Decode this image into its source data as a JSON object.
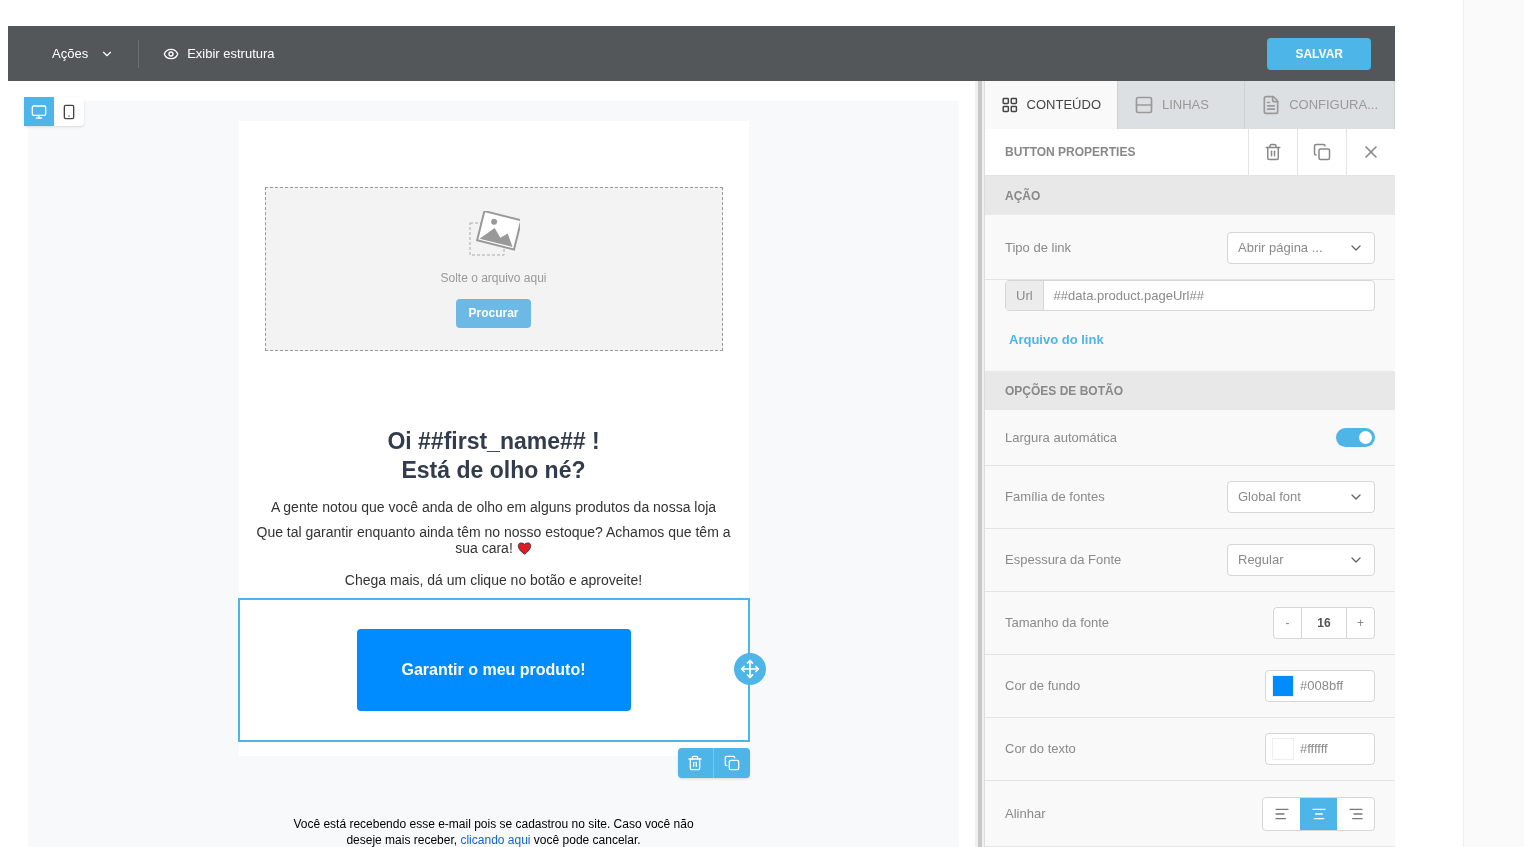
{
  "toolbar": {
    "actions_menu": "Ações",
    "structure_toggle": "Exibir estrutura",
    "save_button": "SALVAR"
  },
  "device_toggle": [
    {
      "kind": "desktop",
      "selected": true
    },
    {
      "kind": "mobile",
      "selected": false
    }
  ],
  "email": {
    "dropzone": {
      "text": "Solte o arquivo aqui",
      "button": "Procurar"
    },
    "heading": [
      "Oi ##first_name## !",
      "Está de olho né?"
    ],
    "paragraphs": [
      "A gente notou que você anda de olho em alguns produtos da nossa loja",
      "Que tal garantir enquanto ainda têm no nosso estoque? Achamos que têm a sua cara!",
      "Chega mais, dá um clique no botão e aproveite!"
    ],
    "cta_button": "Garantir o meu produto!",
    "footer": {
      "before": "Você está recebendo esse e-mail pois se cadastrou no site. Caso você não deseje mais receber,",
      "link": "clicando aqui",
      "after": "você pode cancelar."
    }
  },
  "panel": {
    "tabs": [
      {
        "label": "CONTEÚDO",
        "kind": "grid",
        "selected": true
      },
      {
        "label": "LINHAS",
        "kind": "rows",
        "selected": false
      },
      {
        "label": "CONFIGURA...",
        "kind": "doc",
        "selected": false
      }
    ],
    "title": "BUTTON PROPERTIES",
    "sections": [
      {
        "title": "AÇÃO",
        "rows": [
          {
            "kind": "select",
            "label": "Tipo de link",
            "value": "Abrir página ..."
          },
          {
            "kind": "url",
            "addon": "Url",
            "value": "##data.product.pageUrl##"
          },
          {
            "kind": "link",
            "label": "Arquivo do link"
          }
        ]
      },
      {
        "title": "OPÇÕES DE BOTÃO",
        "rows": [
          {
            "kind": "toggle",
            "label": "Largura automática",
            "on": true
          },
          {
            "kind": "select",
            "label": "Família de fontes",
            "value": "Global font"
          },
          {
            "kind": "select",
            "label": "Espessura da Fonte",
            "value": "Regular"
          },
          {
            "kind": "stepper",
            "label": "Tamanho da fonte",
            "minus": "-",
            "value": "16",
            "plus": "+"
          },
          {
            "kind": "color",
            "label": "Cor de fundo",
            "color": "#008bff",
            "value": "#008bff"
          },
          {
            "kind": "color",
            "label": "Cor do texto",
            "color": "#ffffff",
            "value": "#ffffff"
          },
          {
            "kind": "align",
            "label": "Alinhar",
            "options": [
              {
                "kind": "left",
                "selected": false
              },
              {
                "kind": "center",
                "selected": true
              },
              {
                "kind": "right",
                "selected": false
              }
            ]
          }
        ]
      }
    ]
  }
}
